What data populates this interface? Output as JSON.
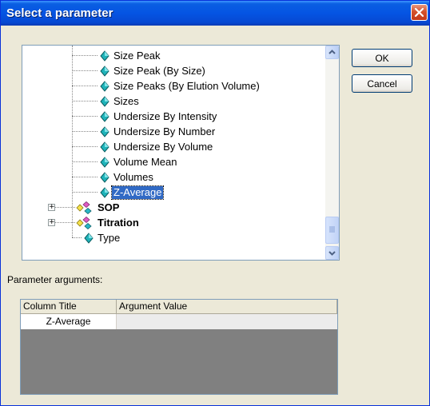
{
  "window": {
    "title": "Select a parameter"
  },
  "tree": {
    "items": [
      {
        "label": "Size Peak",
        "icon": "diamond-param-icon"
      },
      {
        "label": "Size Peak (By Size)",
        "icon": "diamond-param-icon"
      },
      {
        "label": "Size Peaks (By Elution Volume)",
        "icon": "diamond-param-icon"
      },
      {
        "label": "Sizes",
        "icon": "diamond-param-icon"
      },
      {
        "label": "Undersize By Intensity",
        "icon": "diamond-param-icon"
      },
      {
        "label": "Undersize By Number",
        "icon": "diamond-param-icon"
      },
      {
        "label": "Undersize By Volume",
        "icon": "diamond-param-icon"
      },
      {
        "label": "Volume Mean",
        "icon": "diamond-param-icon"
      },
      {
        "label": "Volumes",
        "icon": "diamond-param-icon"
      },
      {
        "label": "Z-Average",
        "icon": "diamond-param-icon",
        "selected": true
      },
      {
        "label": "SOP",
        "icon": "group-icon",
        "expander": "+"
      },
      {
        "label": "Titration",
        "icon": "group-icon",
        "expander": "+"
      },
      {
        "label": "Type",
        "icon": "diamond-param-icon"
      }
    ]
  },
  "buttons": {
    "ok": "OK",
    "cancel": "Cancel"
  },
  "arguments": {
    "label": "Parameter arguments:",
    "columns": [
      "Column Title",
      "Argument Value"
    ],
    "rows": [
      [
        "Z-Average",
        ""
      ]
    ]
  },
  "colors": {
    "title_bar": "#0554e3",
    "selection": "#316ac5",
    "grid_empty": "#808080"
  }
}
